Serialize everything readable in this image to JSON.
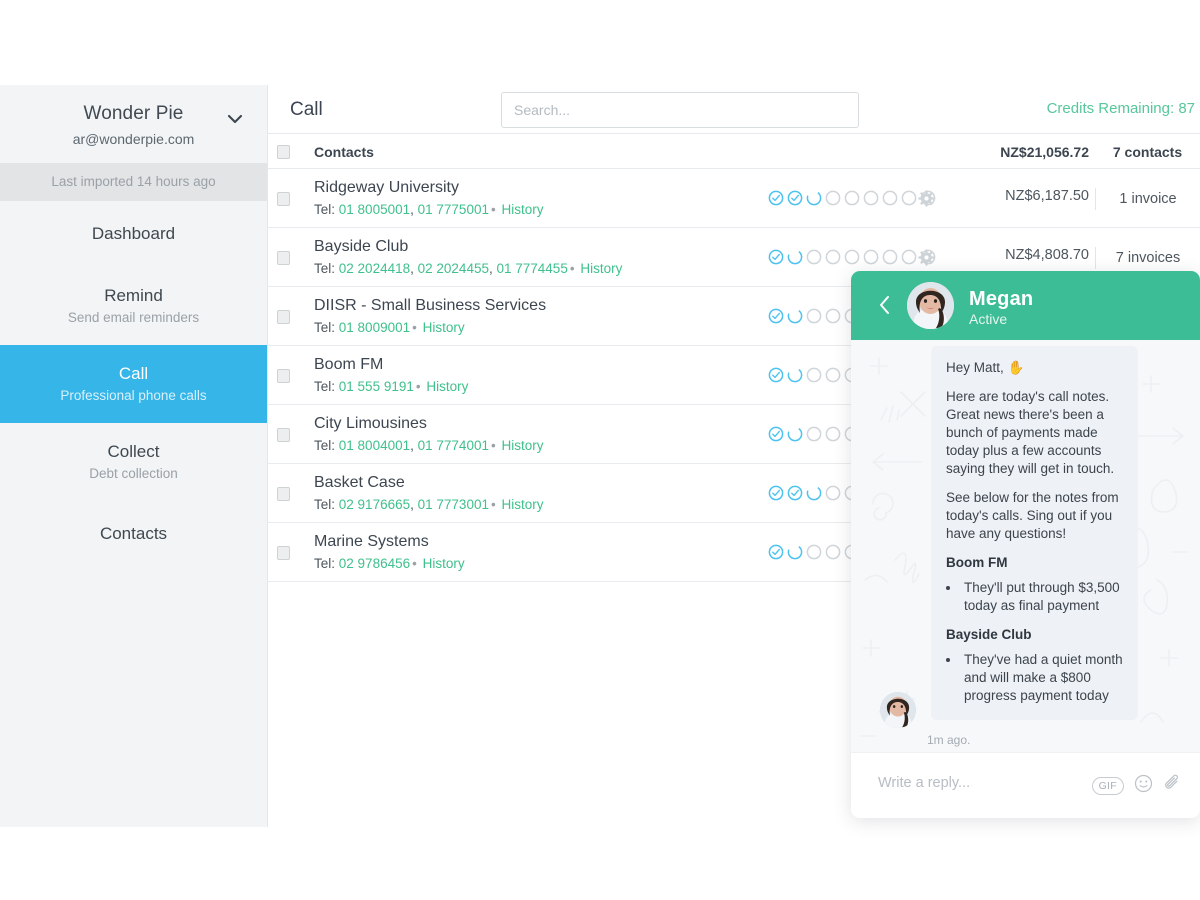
{
  "sidebar": {
    "org_name": "Wonder Pie",
    "org_email": "ar@wonderpie.com",
    "chevron_icon": "chevron-down-icon",
    "imported_status": "Last imported 14 hours ago",
    "items": [
      {
        "label": "Dashboard",
        "sub": "",
        "active": false
      },
      {
        "label": "Remind",
        "sub": "Send email reminders",
        "active": false
      },
      {
        "label": "Call",
        "sub": "Professional phone calls",
        "active": true
      },
      {
        "label": "Collect",
        "sub": "Debt collection",
        "active": false
      },
      {
        "label": "Contacts",
        "sub": "",
        "active": false
      }
    ]
  },
  "topbar": {
    "title": "Call",
    "search_placeholder": "Search...",
    "search_value": "",
    "credits": "Credits Remaining: 87"
  },
  "table": {
    "header": {
      "contacts_label": "Contacts",
      "total_amount": "NZ$21,056.72",
      "contacts_count": "7 contacts"
    },
    "rows": [
      {
        "name": "Ridgeway University",
        "tel_prefix": "Tel:",
        "numbers": [
          "01 8005001",
          "01 7775001"
        ],
        "history": "History",
        "dots_done": 2,
        "dots_active": 1,
        "dots_total": 9,
        "gear_icon": "gear-icon",
        "amount": "NZ$6,187.50",
        "invoices": "1 invoice"
      },
      {
        "name": "Bayside Club",
        "tel_prefix": "Tel:",
        "numbers": [
          "02 2024418",
          "02 2024455",
          "01 7774455"
        ],
        "history": "History",
        "dots_done": 1,
        "dots_active": 1,
        "dots_total": 9,
        "gear_icon": "gear-icon",
        "amount": "NZ$4,808.70",
        "invoices": "7 invoices"
      },
      {
        "name": "DIISR - Small Business Services",
        "tel_prefix": "Tel:",
        "numbers": [
          "01 8009001"
        ],
        "history": "History",
        "dots_done": 1,
        "dots_active": 1,
        "dots_total": 9,
        "gear_icon": "gear-icon",
        "amount": "",
        "invoices": ""
      },
      {
        "name": "Boom FM",
        "tel_prefix": "Tel:",
        "numbers": [
          "01 555 9191"
        ],
        "history": "History",
        "dots_done": 1,
        "dots_active": 1,
        "dots_total": 9,
        "gear_icon": "gear-icon",
        "amount": "",
        "invoices": ""
      },
      {
        "name": "City Limousines",
        "tel_prefix": "Tel:",
        "numbers": [
          "01 8004001",
          "01 7774001"
        ],
        "history": "History",
        "dots_done": 1,
        "dots_active": 1,
        "dots_total": 9,
        "gear_icon": "gear-icon",
        "amount": "",
        "invoices": ""
      },
      {
        "name": "Basket Case",
        "tel_prefix": "Tel:",
        "numbers": [
          "02 9176665",
          "01 7773001"
        ],
        "history": "History",
        "dots_done": 2,
        "dots_active": 1,
        "dots_total": 9,
        "gear_icon": "gear-icon",
        "amount": "",
        "invoices": ""
      },
      {
        "name": "Marine Systems",
        "tel_prefix": "Tel:",
        "numbers": [
          "02 9786456"
        ],
        "history": "History",
        "dots_done": 1,
        "dots_active": 1,
        "dots_total": 9,
        "gear_icon": "gear-icon",
        "amount": "",
        "invoices": ""
      }
    ]
  },
  "chat": {
    "back_icon": "chevron-left-icon",
    "avatar_icon": "avatar",
    "name": "Megan",
    "status": "Active",
    "message": {
      "greeting": "Hey Matt, ✋",
      "para1": "Here are today's call notes. Great news there's been a bunch of payments made today plus a few accounts saying they will get in touch.",
      "para2": "See below for the notes from today's calls. Sing out if you have any questions!",
      "sections": [
        {
          "heading": "Boom FM",
          "bullets": [
            "They'll put through $3,500 today as final payment"
          ]
        },
        {
          "heading": "Bayside Club",
          "bullets": [
            "They've had a quiet month and will make a $800 progress payment today"
          ]
        }
      ]
    },
    "timestamp": "1m ago.",
    "reply_placeholder": "Write a reply...",
    "reply_value": "",
    "gif_label": "GIF",
    "emoji_icon": "smiley-icon",
    "attach_icon": "paperclip-icon"
  },
  "colors": {
    "accent_blue": "#35b5e8",
    "accent_green": "#3dbd95",
    "link_green": "#3fc08c",
    "text_dark": "#3d4650",
    "text_muted": "#9aa1a7",
    "sidebar_bg": "#f2f4f5",
    "chat_bubble": "#eef1f5"
  }
}
